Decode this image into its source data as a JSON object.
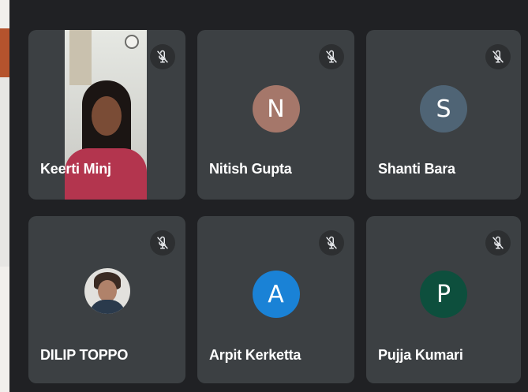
{
  "colors": {
    "background": "#202124",
    "tile": "#3c4043",
    "avatar_n": "#a5776a",
    "avatar_s": "#4f6475",
    "avatar_a": "#1a82d6",
    "avatar_p": "#0d4f3d"
  },
  "participants": [
    {
      "name": "Keerti Minj",
      "tile": "video",
      "muted": true
    },
    {
      "name": "Nitish Gupta",
      "initial": "N",
      "avatar_color": "#a5776a",
      "muted": true
    },
    {
      "name": "Shanti Bara",
      "initial": "S",
      "avatar_color": "#4f6475",
      "muted": true
    },
    {
      "name": "DILIP TOPPO",
      "tile": "photo",
      "muted": true
    },
    {
      "name": "Arpit Kerketta",
      "initial": "A",
      "avatar_color": "#1a82d6",
      "muted": true
    },
    {
      "name": "Pujja Kumari",
      "initial": "P",
      "avatar_color": "#0d4f3d",
      "muted": true
    }
  ],
  "icons": {
    "mute": "mic-off-icon"
  }
}
